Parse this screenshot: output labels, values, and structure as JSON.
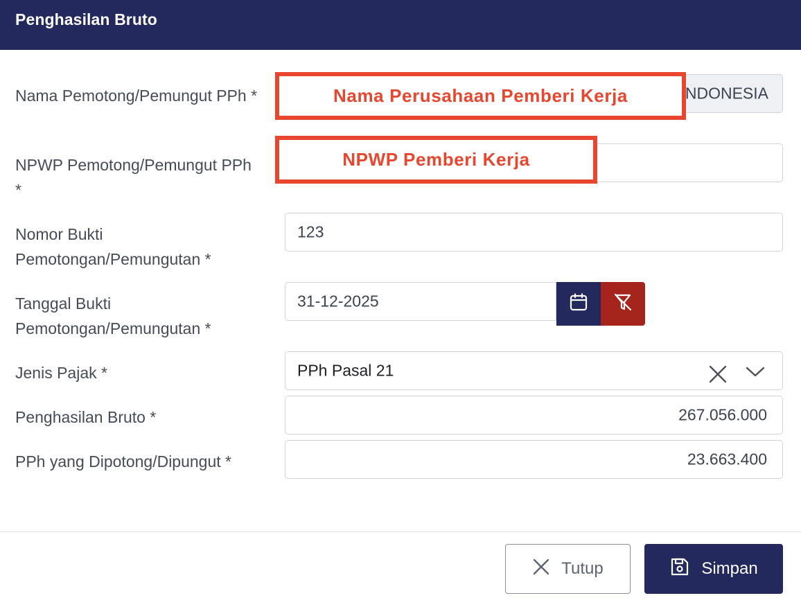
{
  "dialog": {
    "title": "Penghasilan Bruto"
  },
  "form": {
    "nama_label": "Nama Pemotong/Pemungut PPh *",
    "nama_value_visible": "NDONESIA",
    "nama_annotation": "Nama Perusahaan Pemberi Kerja",
    "npwp_label": "NPWP Pemotong/Pemungut PPh *",
    "npwp_annotation": "NPWP Pemberi Kerja",
    "nomor_label": "Nomor Bukti Pemotongan/Pemungutan *",
    "nomor_value": "123",
    "tanggal_label": "Tanggal Bukti Pemotongan/Pemungutan *",
    "tanggal_value": "31-12-2025",
    "jenis_label": "Jenis Pajak *",
    "jenis_value": "PPh Pasal 21",
    "bruto_label": "Penghasilan Bruto *",
    "bruto_value": "267.056.000",
    "pph_label": "PPh yang Dipotong/Dipungut *",
    "pph_value": "23.663.400"
  },
  "footer": {
    "close_label": "Tutup",
    "save_label": "Simpan"
  },
  "colors": {
    "header": "#23295c",
    "annotation": "#e8462e",
    "clear_button": "#a5251c",
    "save_button": "#23295c"
  },
  "icons": {
    "calendar": "calendar-icon",
    "clear_filter": "filter-clear-icon",
    "clear_select": "close-icon",
    "dropdown": "chevron-down-icon",
    "close": "close-icon",
    "save": "save-icon"
  }
}
